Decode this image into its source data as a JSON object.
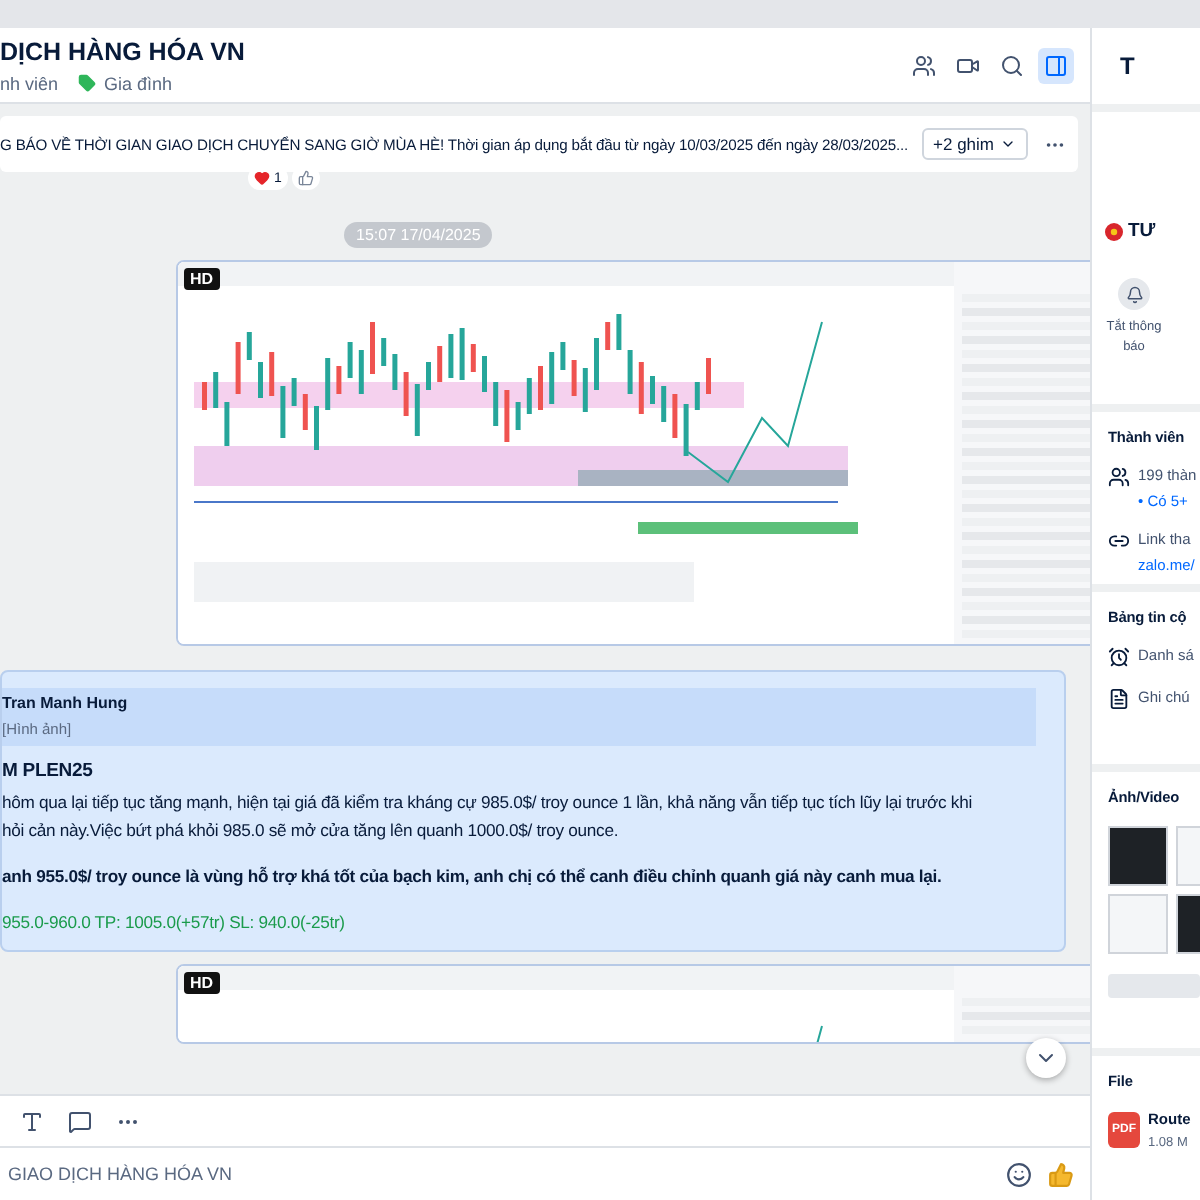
{
  "header": {
    "title": "DỊCH HÀNG HÓA VN",
    "members": "nh viên",
    "tag": {
      "label": "Gia đình",
      "color": "#2fb65a"
    }
  },
  "header_buttons": [
    {
      "kind": "members",
      "selected": false
    },
    {
      "kind": "video",
      "selected": false
    },
    {
      "kind": "search",
      "selected": false
    },
    {
      "kind": "panel",
      "selected": true
    }
  ],
  "pinned": {
    "text": "G BÁO VỀ THỜI GIAN GIAO DỊCH CHUYỂN SANG GIỜ MÙA HÈ! Thời gian áp dụng bắt đầu từ ngày 10/03/2025 đến ngày 28/03/2025...",
    "more": "+2 ghim"
  },
  "reaction": {
    "count": "1"
  },
  "messages": [
    {
      "kind": "timestamp",
      "text": "15:07 17/04/2025"
    },
    {
      "kind": "image",
      "badge": "HD"
    },
    {
      "kind": "reply",
      "quote": {
        "author": "Tran Manh Hung",
        "text": "[Hình ảnh]"
      },
      "lines": [
        {
          "kind": "heading",
          "text": "M PLEN25"
        },
        {
          "kind": "body",
          "text": "hôm qua lại tiếp tục tăng mạnh, hiện tại giá đã kiểm tra kháng cự 985.0$/ troy ounce 1 lần, khả năng vẫn tiếp tục tích lũy lại trước khi"
        },
        {
          "kind": "body",
          "text": "hỏi cản này.Việc bứt phá khỏi 985.0 sẽ mở cửa tăng lên quanh 1000.0$/ troy ounce."
        },
        {
          "kind": "bold",
          "text": "anh 955.0$/ troy ounce là vùng hỗ trợ khá tốt của bạch kim, anh chị có thể canh điều chỉnh quanh giá này canh mua lại."
        },
        {
          "kind": "signal",
          "text": "955.0-960.0  TP: 1005.0(+57tr)  SL: 940.0(-25tr)"
        }
      ]
    },
    {
      "kind": "image",
      "badge": "HD"
    }
  ],
  "composer": {
    "placeholder": "GIAO DỊCH HÀNG HÓA VN"
  },
  "info_panel": {
    "title": "T",
    "group_name": "TƯ",
    "mute_label": "Tắt thông báo",
    "sections": [
      {
        "kind": "list",
        "title": "Thành viên",
        "items": [
          {
            "kind": "members",
            "lines": [
              "199 thàn",
              "• Có 5+"
            ]
          },
          {
            "kind": "link",
            "lines": [
              "Link tha",
              "zalo.me/"
            ]
          }
        ]
      },
      {
        "kind": "list",
        "title": "Bảng tin cộ",
        "items": [
          {
            "kind": "reminder",
            "lines": [
              "Danh sá"
            ]
          },
          {
            "kind": "note",
            "lines": [
              "Ghi chú"
            ]
          }
        ]
      },
      {
        "kind": "media",
        "title": "Ảnh/Video"
      },
      {
        "kind": "files",
        "title": "File",
        "files": [
          {
            "name": "Route",
            "size": "1.08 M",
            "type": "PDF"
          }
        ]
      }
    ]
  }
}
